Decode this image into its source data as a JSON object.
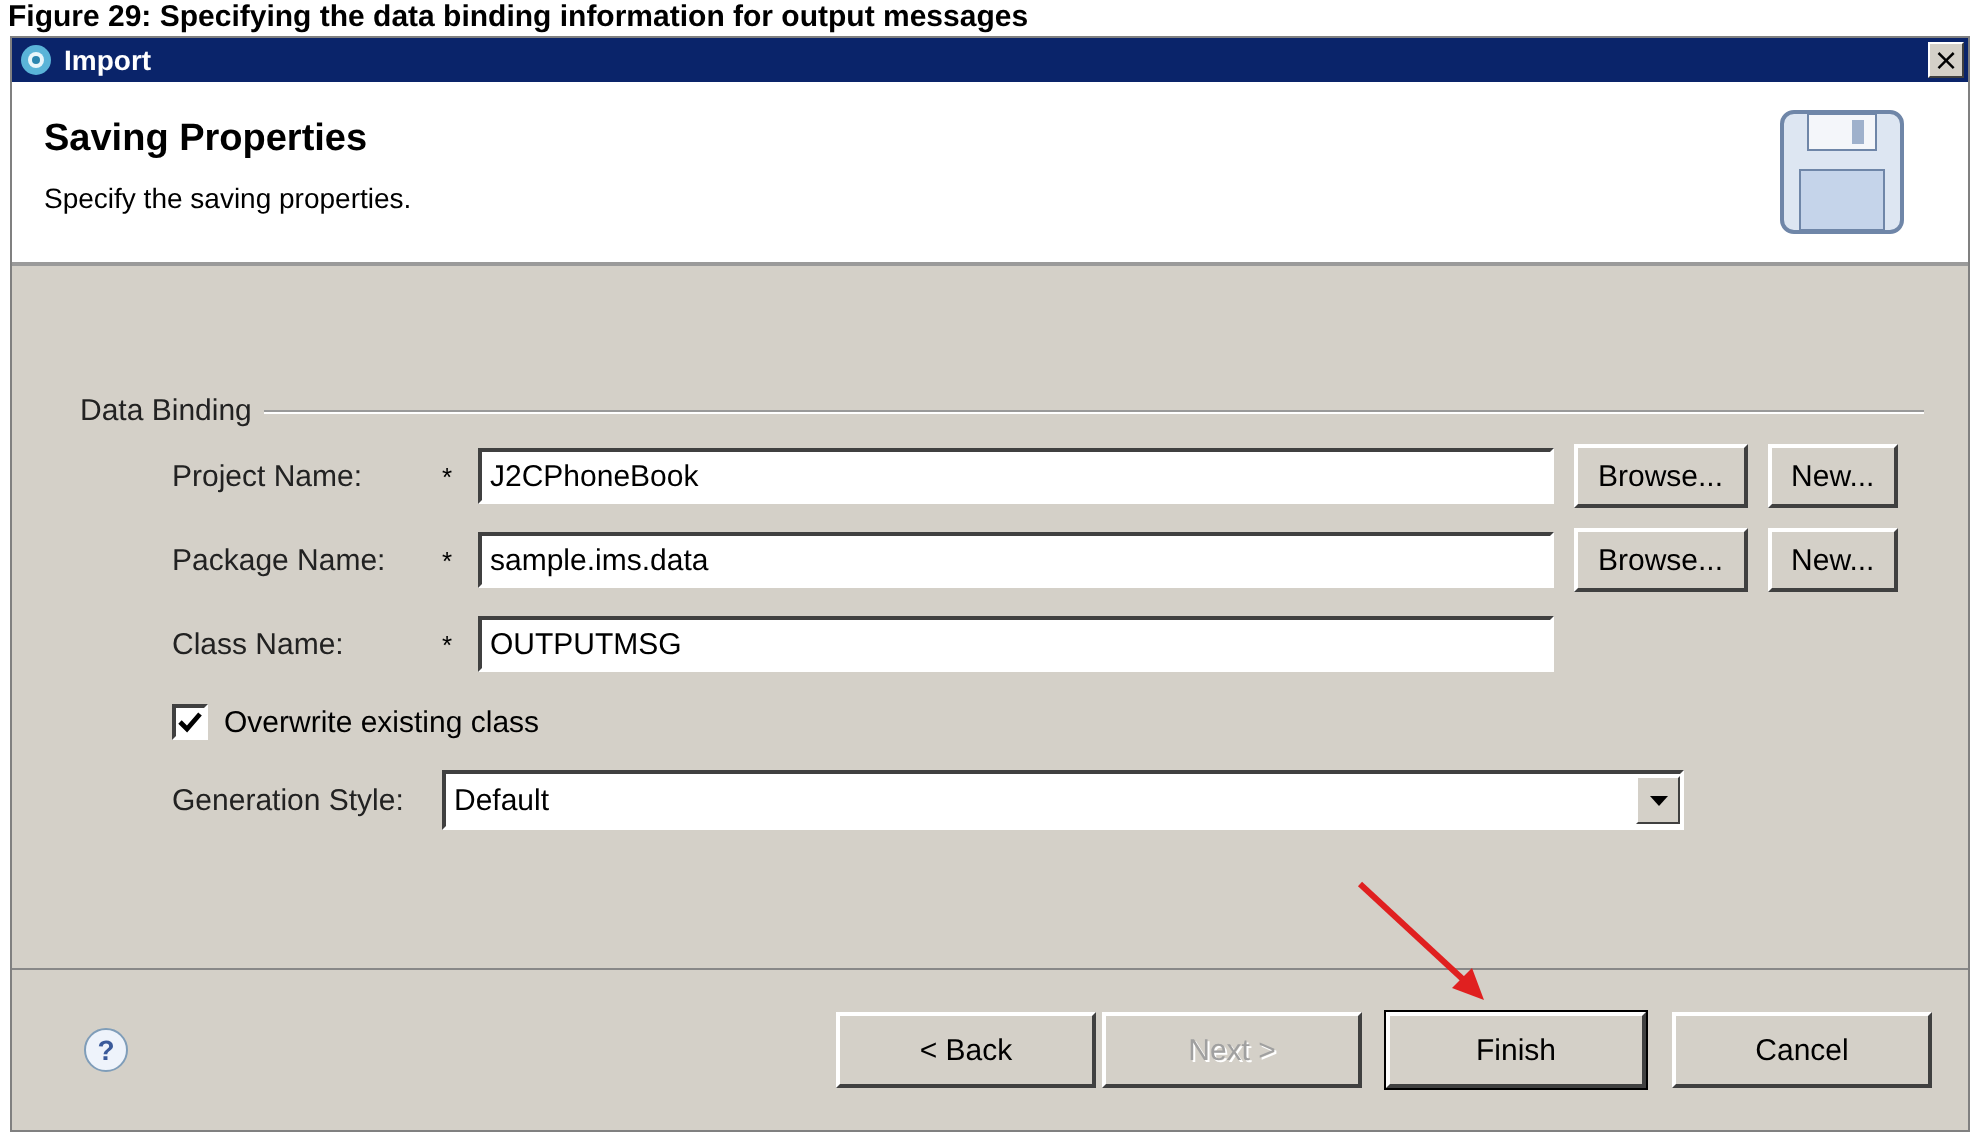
{
  "caption": "Figure 29: Specifying the data binding information for output messages",
  "window": {
    "title": "Import",
    "close": "×"
  },
  "header": {
    "title": "Saving Properties",
    "description": "Specify the saving properties."
  },
  "group": {
    "label": "Data Binding",
    "rows": [
      {
        "kind": "text",
        "label": "Project Name:",
        "required": "*",
        "value": "J2CPhoneBook",
        "buttons": [
          "Browse...",
          "New..."
        ]
      },
      {
        "kind": "text",
        "label": "Package Name:",
        "required": "*",
        "value": "sample.ims.data",
        "buttons": [
          "Browse...",
          "New..."
        ]
      },
      {
        "kind": "text",
        "label": "Class Name:",
        "required": "*",
        "value": "OUTPUTMSG",
        "buttons": []
      },
      {
        "kind": "checkbox",
        "label": "Overwrite existing class",
        "checked": true
      },
      {
        "kind": "dropdown",
        "label": "Generation Style:",
        "value": "Default"
      }
    ]
  },
  "footer": {
    "help": "?",
    "buttons": [
      {
        "label": "< Back",
        "disabled": false,
        "default": false
      },
      {
        "label": "Next >",
        "disabled": true,
        "default": false
      },
      {
        "label": "Finish",
        "disabled": false,
        "default": true
      },
      {
        "label": "Cancel",
        "disabled": false,
        "default": false
      }
    ]
  }
}
